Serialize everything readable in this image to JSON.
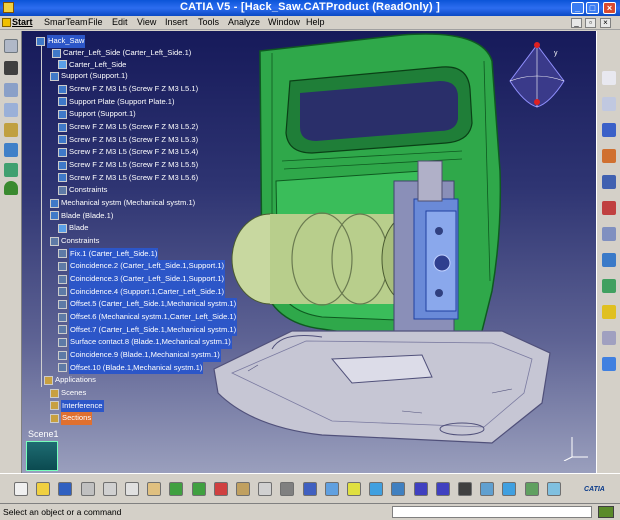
{
  "window": {
    "title": "CATIA V5 - [Hack_Saw.CATProduct (ReadOnly) ]",
    "buttons": [
      "_",
      "□",
      "×"
    ]
  },
  "menu": {
    "items": [
      "Start",
      "SmarTeam",
      "File",
      "Edit",
      "View",
      "Insert",
      "Tools",
      "Analyze",
      "Window",
      "Help"
    ],
    "right_buttons": [
      "_",
      "▫",
      "×"
    ]
  },
  "tree": {
    "root": "Hack_Saw",
    "nodes": [
      {
        "label": "Carter_Left_Side (Carter_Left_Side.1)",
        "icon": "product-icon"
      },
      {
        "label": "Carter_Left_Side",
        "icon": "part-icon"
      },
      {
        "label": "Support (Support.1)",
        "icon": "product-icon"
      },
      {
        "label": "Screw F Z M3 L5 (Screw F Z M3 L5.1)",
        "icon": "product-icon"
      },
      {
        "label": "Support Plate (Support Plate.1)",
        "icon": "product-icon"
      },
      {
        "label": "Support (Support.1)",
        "icon": "product-icon"
      },
      {
        "label": "Screw F Z M3 L5 (Screw F Z M3 L5.2)",
        "icon": "product-icon"
      },
      {
        "label": "Screw F Z M3 L5 (Screw F Z M3 L5.3)",
        "icon": "product-icon"
      },
      {
        "label": "Screw F Z M3 L5 (Screw F Z M3 L5.4)",
        "icon": "product-icon"
      },
      {
        "label": "Screw F Z M3 L5 (Screw F Z M3 L5.5)",
        "icon": "product-icon"
      },
      {
        "label": "Screw F Z M3 L5 (Screw F Z M3 L5.6)",
        "icon": "product-icon"
      },
      {
        "label": "Constraints",
        "icon": "constraints-icon"
      },
      {
        "label": "Mechanical systm (Mechanical systm.1)",
        "icon": "product-icon"
      },
      {
        "label": "Blade (Blade.1)",
        "icon": "product-icon"
      },
      {
        "label": "Blade",
        "icon": "part-icon"
      },
      {
        "label": "Constraints",
        "icon": "constraints-icon"
      },
      {
        "label": "Fix.1 (Carter_Left_Side.1)",
        "icon": "constraint-icon"
      },
      {
        "label": "Coincidence.2 (Carter_Left_Side.1,Support.1)",
        "icon": "constraint-icon"
      },
      {
        "label": "Coincidence.3 (Carter_Left_Side.1,Support.1)",
        "icon": "constraint-icon"
      },
      {
        "label": "Coincidence.4 (Support.1,Carter_Left_Side.1)",
        "icon": "constraint-icon"
      },
      {
        "label": "Offset.5 (Carter_Left_Side.1,Mechanical systm.1)",
        "icon": "constraint-icon"
      },
      {
        "label": "Offset.6 (Mechanical systm.1,Carter_Left_Side.1)",
        "icon": "constraint-icon"
      },
      {
        "label": "Offset.7 (Carter_Left_Side.1,Mechanical systm.1)",
        "icon": "constraint-icon"
      },
      {
        "label": "Surface contact.8 (Blade.1,Mechanical systm.1)",
        "icon": "constraint-icon"
      },
      {
        "label": "Coincidence.9 (Blade.1,Mechanical systm.1)",
        "icon": "constraint-icon"
      },
      {
        "label": "Offset.10 (Blade.1,Mechanical systm.1)",
        "icon": "constraint-icon"
      },
      {
        "label": "Applications",
        "icon": "applications-icon"
      },
      {
        "label": "Scenes",
        "icon": "scenes-icon"
      },
      {
        "label": "Interference",
        "icon": "interference-icon"
      },
      {
        "label": "Sections",
        "icon": "sections-icon"
      }
    ]
  },
  "scene": {
    "label": "Scene1"
  },
  "status": {
    "text": "Select an object or a command"
  },
  "logo": {
    "text": "CATIA"
  },
  "colors": {
    "titlebar": "#0b54d8",
    "model_green": "#2fa84a",
    "selection_highlight": "#2c56c8",
    "active_item": "#e07030"
  },
  "toolbars": {
    "left": [
      "product-icon",
      "tools-icon",
      "catalog-icon",
      "cube-icon",
      "analysis-icon",
      "sketch-icon",
      "tree-icon",
      "palm-icon"
    ],
    "right": [
      "select-icon",
      "snap-icon",
      "constraint-icon",
      "surface-icon",
      "manipulate-icon",
      "explode-icon",
      "clash-icon",
      "section-icon",
      "distance-icon",
      "annotation-icon",
      "capture-icon",
      "scene-icon"
    ],
    "bottom": [
      "new-icon",
      "open-icon",
      "save-icon",
      "print-icon",
      "cut-icon",
      "copy-icon",
      "paste-icon",
      "undo-icon",
      "redo-icon",
      "help-icon",
      "formula-icon",
      "knowledge-icon",
      "table-icon",
      "view-icon",
      "fly-icon",
      "fit-all-icon",
      "pan-icon",
      "rotate-icon",
      "zoom-in-icon",
      "zoom-out-icon",
      "normal-view-icon",
      "iso-view-icon",
      "render-icon",
      "hide-show-icon",
      "swap-icon"
    ]
  }
}
